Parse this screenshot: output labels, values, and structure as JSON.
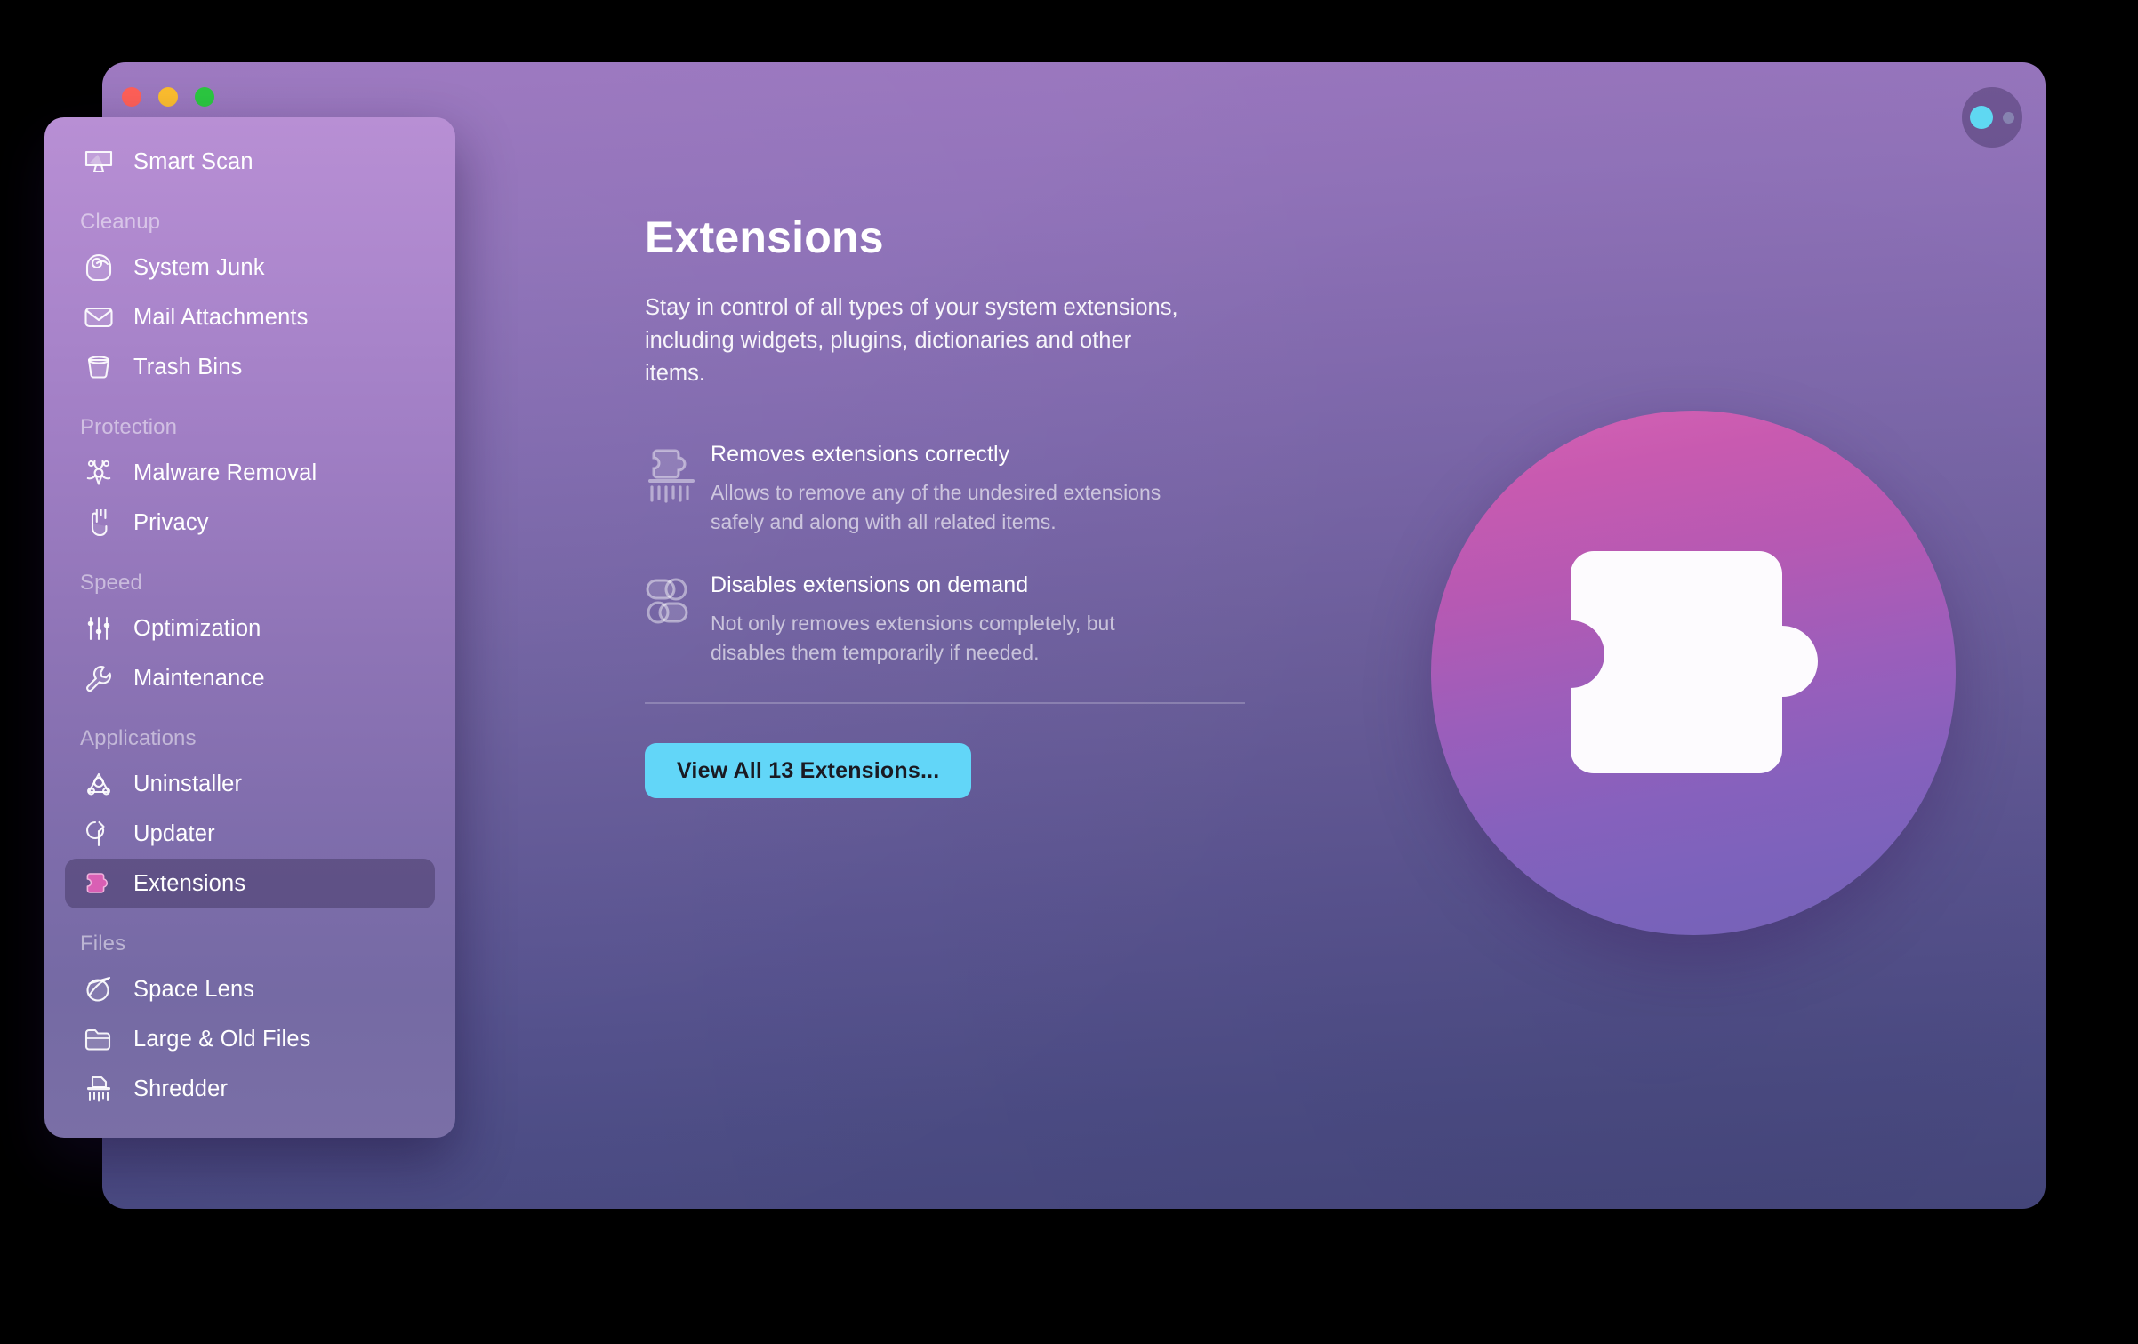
{
  "window": {
    "traffic_lights": [
      {
        "name": "close",
        "color": "#ff6058"
      },
      {
        "name": "minimize",
        "color": "#fcbd2e"
      },
      {
        "name": "maximize",
        "color": "#2bc840"
      }
    ],
    "account_badge": {
      "icon": "account-status-icon",
      "accent_color": "#5fd8f2"
    },
    "background_gradient": [
      "#9d78c0",
      "#46477d"
    ]
  },
  "sidebar": {
    "groups": [
      {
        "section": null,
        "items": [
          {
            "label": "Smart Scan",
            "icon": "display-scan-icon",
            "selected": false
          }
        ]
      },
      {
        "section": "Cleanup",
        "items": [
          {
            "label": "System Junk",
            "icon": "broom-bucket-icon",
            "selected": false
          },
          {
            "label": "Mail Attachments",
            "icon": "envelope-icon",
            "selected": false
          },
          {
            "label": "Trash Bins",
            "icon": "trash-bin-icon",
            "selected": false
          }
        ]
      },
      {
        "section": "Protection",
        "items": [
          {
            "label": "Malware Removal",
            "icon": "biohazard-icon",
            "selected": false
          },
          {
            "label": "Privacy",
            "icon": "hand-stop-icon",
            "selected": false
          }
        ]
      },
      {
        "section": "Speed",
        "items": [
          {
            "label": "Optimization",
            "icon": "sliders-icon",
            "selected": false
          },
          {
            "label": "Maintenance",
            "icon": "wrench-icon",
            "selected": false
          }
        ]
      },
      {
        "section": "Applications",
        "items": [
          {
            "label": "Uninstaller",
            "icon": "app-store-icon",
            "selected": false
          },
          {
            "label": "Updater",
            "icon": "refresh-arrow-icon",
            "selected": false
          },
          {
            "label": "Extensions",
            "icon": "puzzle-piece-icon",
            "selected": true
          }
        ]
      },
      {
        "section": "Files",
        "items": [
          {
            "label": "Space Lens",
            "icon": "planet-lens-icon",
            "selected": false
          },
          {
            "label": "Large & Old Files",
            "icon": "folder-icon",
            "selected": false
          },
          {
            "label": "Shredder",
            "icon": "shredder-icon",
            "selected": false
          }
        ]
      }
    ],
    "selected_item": "Extensions",
    "selection_color": "rgba(64,52,96,0.48)"
  },
  "main": {
    "title": "Extensions",
    "description": "Stay in control of all types of your system extensions, including widgets, plugins, dictionaries and other items.",
    "features": [
      {
        "icon": "puzzle-shredder-icon",
        "title": "Removes extensions correctly",
        "text": "Allows to remove any of the undesired extensions safely and along with all related items."
      },
      {
        "icon": "toggle-switches-icon",
        "title": "Disables extensions on demand",
        "text": "Not only removes extensions completely, but disables them temporarily if needed."
      }
    ],
    "cta": {
      "label": "View All 13 Extensions...",
      "count": 13,
      "background_color": "#62d6f8",
      "text_color": "#1a1a22"
    },
    "hero": {
      "icon": "puzzle-piece-hero-icon",
      "gradient": [
        "#d563b4",
        "#7563b6"
      ]
    }
  }
}
